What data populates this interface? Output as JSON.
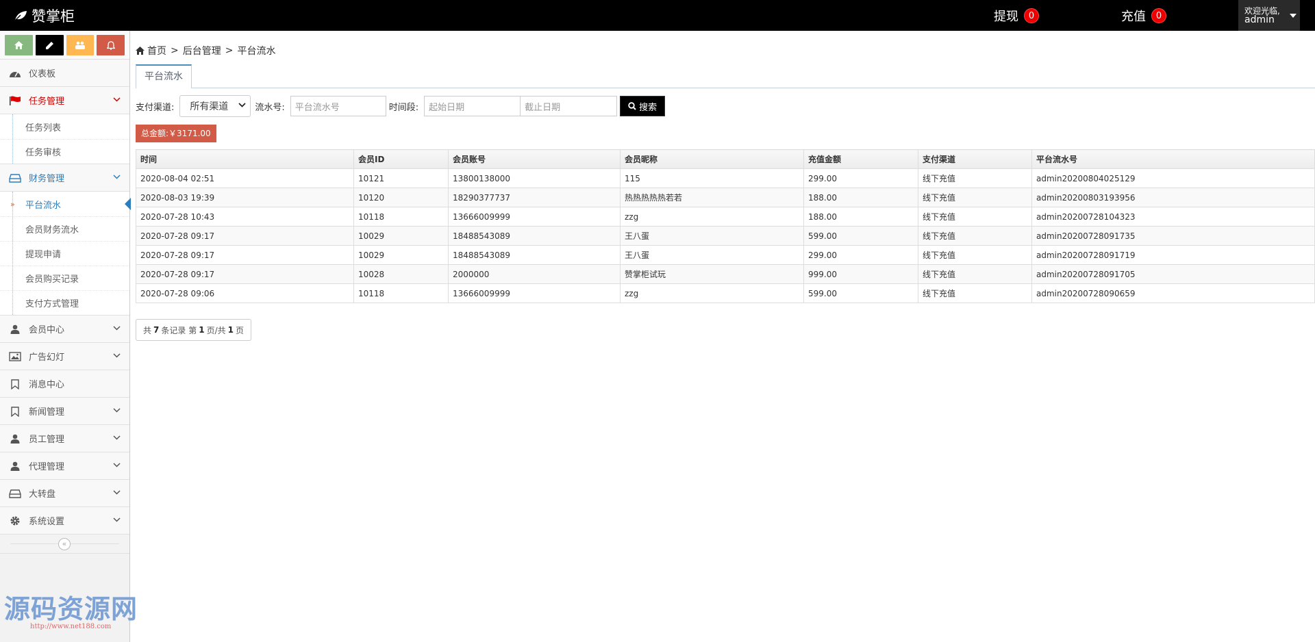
{
  "navbar": {
    "brand": "赞掌柜",
    "withdraw": {
      "label": "提现",
      "count": "0"
    },
    "recharge": {
      "label": "充值",
      "count": "0"
    },
    "user": {
      "welcome": "欢迎光临,",
      "name": "admin"
    }
  },
  "sidebar": {
    "shortcuts": [
      "home-icon",
      "pencil-icon",
      "users-icon",
      "bell-icon"
    ],
    "items": [
      {
        "label": "仪表板",
        "icon": "dashboard-icon"
      },
      {
        "label": "任务管理",
        "icon": "flag-icon",
        "sub": [
          "任务列表",
          "任务审核"
        ]
      },
      {
        "label": "财务管理",
        "icon": "hdd-icon",
        "sub": [
          "平台流水",
          "会员财务流水",
          "提现申请",
          "会员购买记录",
          "支付方式管理"
        ]
      },
      {
        "label": "会员中心",
        "icon": "user-icon"
      },
      {
        "label": "广告幻灯",
        "icon": "picture-icon"
      },
      {
        "label": "消息中心",
        "icon": "bookmark-icon"
      },
      {
        "label": "新闻管理",
        "icon": "bookmark-icon"
      },
      {
        "label": "员工管理",
        "icon": "user-icon"
      },
      {
        "label": "代理管理",
        "icon": "user-icon"
      },
      {
        "label": "大转盘",
        "icon": "hdd-icon"
      },
      {
        "label": "系统设置",
        "icon": "gear-icon"
      }
    ]
  },
  "watermark": {
    "text": "源码资源网",
    "url": "http://www.net188.com"
  },
  "breadcrumb": {
    "home": "首页",
    "level1": "后台管理",
    "level2": "平台流水"
  },
  "tab": "平台流水",
  "filters": {
    "channel_label": "支付渠道:",
    "channel_value": "所有渠道",
    "serial_label": "流水号:",
    "serial_placeholder": "平台流水号",
    "period_label": "时间段:",
    "start_placeholder": "起始日期",
    "end_placeholder": "截止日期",
    "search_label": "搜索"
  },
  "total": "总金额:￥3171.00",
  "table": {
    "headers": [
      "时间",
      "会员ID",
      "会员账号",
      "会员昵称",
      "充值金额",
      "支付渠道",
      "平台流水号"
    ],
    "rows": [
      [
        "2020-08-04 02:51",
        "10121",
        "13800138000",
        "115",
        "299.00",
        "线下充值",
        "admin20200804025129"
      ],
      [
        "2020-08-03 19:39",
        "10120",
        "18290377737",
        "热热热热热若若",
        "188.00",
        "线下充值",
        "admin20200803193956"
      ],
      [
        "2020-07-28 10:43",
        "10118",
        "13666009999",
        "zzg",
        "188.00",
        "线下充值",
        "admin20200728104323"
      ],
      [
        "2020-07-28 09:17",
        "10029",
        "18488543089",
        "王八蛋",
        "599.00",
        "线下充值",
        "admin20200728091735"
      ],
      [
        "2020-07-28 09:17",
        "10029",
        "18488543089",
        "王八蛋",
        "299.00",
        "线下充值",
        "admin20200728091719"
      ],
      [
        "2020-07-28 09:17",
        "10028",
        "2000000",
        "赞掌柜试玩",
        "999.00",
        "线下充值",
        "admin20200728091705"
      ],
      [
        "2020-07-28 09:06",
        "10118",
        "13666009999",
        "zzg",
        "599.00",
        "线下充值",
        "admin20200728090659"
      ]
    ]
  },
  "pager": {
    "prefix": "共",
    "records": "7",
    "mid1": "条记录 第",
    "page": "1",
    "mid2": "页/共",
    "pages": "1",
    "suffix": "页"
  }
}
